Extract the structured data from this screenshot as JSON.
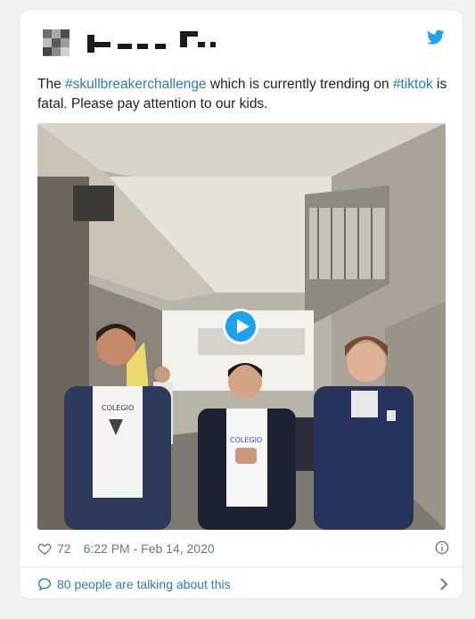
{
  "tweet": {
    "text_prefix": "The ",
    "hashtag1": "#skullbreakerchallenge",
    "text_middle": " which is currently trending on ",
    "hashtag2": "#tiktok",
    "text_suffix": " is fatal. Please pay attention to our kids.",
    "likes": "72",
    "timestamp": "6:22 PM - Feb 14, 2020",
    "talk_label": "80 people are talking about this"
  },
  "icons": {
    "brand": "twitter-bird-icon",
    "likes": "heart-icon",
    "info": "info-icon",
    "talk": "speech-bubble-icon",
    "talk_arrow": "chevron-right-icon",
    "media": "play-icon"
  },
  "colors": {
    "link": "#2b7bb9",
    "brand": "#1da1f2",
    "meta": "#697882",
    "text": "#1c2022"
  },
  "video_shirt_text": [
    "COLEGIO",
    "COLEGIO"
  ]
}
